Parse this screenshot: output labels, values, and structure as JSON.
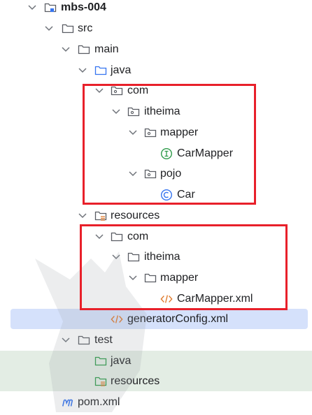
{
  "tree": {
    "items": [
      {
        "label": "mbs-004",
        "icon": "module-folder-icon",
        "expanded": true
      },
      {
        "label": "src",
        "icon": "folder-icon",
        "expanded": true
      },
      {
        "label": "main",
        "icon": "folder-icon",
        "expanded": true
      },
      {
        "label": "java",
        "icon": "source-root-folder-icon",
        "expanded": true
      },
      {
        "label": "com",
        "icon": "package-icon",
        "expanded": true
      },
      {
        "label": "itheima",
        "icon": "package-icon",
        "expanded": true
      },
      {
        "label": "mapper",
        "icon": "package-icon",
        "expanded": true
      },
      {
        "label": "CarMapper",
        "icon": "interface-icon"
      },
      {
        "label": "pojo",
        "icon": "package-icon",
        "expanded": true
      },
      {
        "label": "Car",
        "icon": "class-icon"
      },
      {
        "label": "resources",
        "icon": "resources-folder-icon",
        "expanded": true
      },
      {
        "label": "com",
        "icon": "folder-icon",
        "expanded": true
      },
      {
        "label": "itheima",
        "icon": "folder-icon",
        "expanded": true
      },
      {
        "label": "mapper",
        "icon": "folder-icon",
        "expanded": true
      },
      {
        "label": "CarMapper.xml",
        "icon": "xml-file-icon"
      },
      {
        "label": "generatorConfig.xml",
        "icon": "xml-file-icon",
        "selected": true
      },
      {
        "label": "test",
        "icon": "folder-icon",
        "expanded": true
      },
      {
        "label": "java",
        "icon": "test-source-folder-icon"
      },
      {
        "label": "resources",
        "icon": "test-resources-folder-icon"
      },
      {
        "label": "pom.xml",
        "icon": "maven-icon"
      }
    ]
  },
  "colors": {
    "highlight_box": "#e8202a",
    "selection": "#d5e1fb",
    "test_zone": "#e3ede4",
    "xml_icon": "#e07a2c",
    "class_icon": "#3574f0",
    "interface_icon": "#2e9b4a"
  }
}
